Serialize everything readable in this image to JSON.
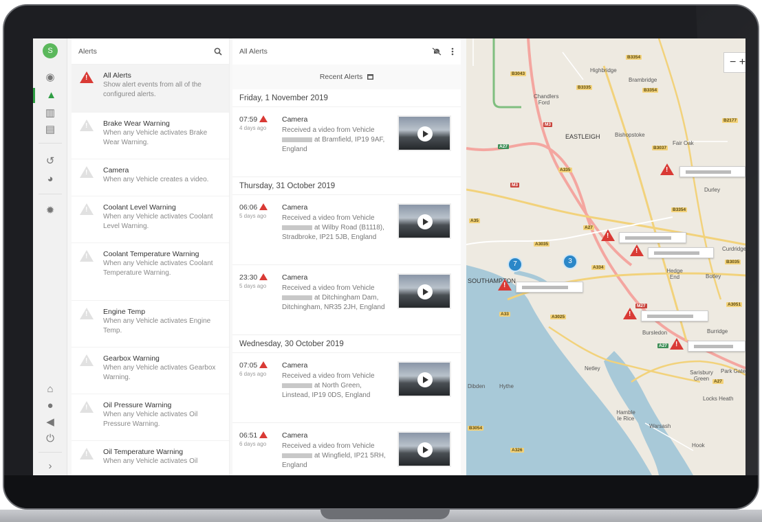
{
  "user": {
    "initial": "S"
  },
  "rail_icons": [
    {
      "name": "compass-icon",
      "glyph": "◉"
    },
    {
      "name": "alert-icon",
      "glyph": "▲"
    },
    {
      "name": "reports-chart-icon",
      "glyph": "▥"
    },
    {
      "name": "calendar-icon",
      "glyph": "▤"
    },
    {
      "name": "history-icon",
      "glyph": "↺"
    },
    {
      "name": "pie-chart-icon",
      "glyph": "◕"
    },
    {
      "name": "settings-gear-icon",
      "glyph": "✹"
    },
    {
      "name": "home-icon",
      "glyph": "⌂"
    },
    {
      "name": "user-icon",
      "glyph": "●"
    },
    {
      "name": "megaphone-icon",
      "glyph": "◀"
    },
    {
      "name": "power-icon",
      "glyph": "⏻"
    },
    {
      "name": "expand-chevron-icon",
      "glyph": "›"
    }
  ],
  "alerts_panel": {
    "title": "Alerts",
    "search_icon": "search-icon",
    "items": [
      {
        "title": "All Alerts",
        "desc": "Show alert events from all of the configured alerts.",
        "selected": true
      },
      {
        "title": "Brake Wear Warning",
        "desc": "When any Vehicle activates Brake Wear Warning."
      },
      {
        "title": "Camera",
        "desc": "When any Vehicle creates a video."
      },
      {
        "title": "Coolant Level Warning",
        "desc": "When any Vehicle activates Coolant Level Warning."
      },
      {
        "title": "Coolant Temperature Warning",
        "desc": "When any Vehicle activates Coolant Temperature Warning."
      },
      {
        "title": "Engine Temp",
        "desc": "When any Vehicle activates Engine Temp."
      },
      {
        "title": "Gearbox Warning",
        "desc": "When any Vehicle activates Gearbox Warning."
      },
      {
        "title": "Oil Pressure Warning",
        "desc": "When any Vehicle activates Oil Pressure Warning."
      },
      {
        "title": "Oil Temperature Warning",
        "desc": "When any Vehicle activates Oil"
      }
    ]
  },
  "events_panel": {
    "title": "All Alerts",
    "subheader": "Recent Alerts",
    "mute_icon": "bell-off-icon",
    "more_icon": "more-vertical-icon",
    "calendar_icon": "calendar-icon",
    "days": [
      {
        "label": "Friday, 1 November 2019",
        "events": [
          {
            "time": "07:59",
            "ago": "4 days ago",
            "type": "Camera",
            "line1": "Received a video from Vehicle",
            "line2": "at Bramfield, IP19 9AF,",
            "line3": "England"
          }
        ]
      },
      {
        "label": "Thursday, 31 October 2019",
        "events": [
          {
            "time": "06:06",
            "ago": "5 days ago",
            "type": "Camera",
            "line1": "Received a video from Vehicle",
            "line2": "at Wilby Road (B1118),",
            "line3": "Stradbroke, IP21 5JB, England"
          },
          {
            "time": "23:30",
            "ago": "5 days ago",
            "type": "Camera",
            "line1": "Received a video from Vehicle",
            "line2": "at Ditchingham Dam,",
            "line3": "Ditchingham, NR35 2JH, England"
          }
        ]
      },
      {
        "label": "Wednesday, 30 October 2019",
        "events": [
          {
            "time": "07:05",
            "ago": "6 days ago",
            "type": "Camera",
            "line1": "Received a video from Vehicle",
            "line2": "at North Green,",
            "line3": "Linstead, IP19 0DS, England"
          },
          {
            "time": "06:51",
            "ago": "6 days ago",
            "type": "Camera",
            "line1": "Received a video from Vehicle",
            "line2": "at Wingfield, IP21 5RH,",
            "line3": "England"
          }
        ]
      }
    ]
  },
  "map": {
    "zoom_out": "−",
    "zoom_in": "+",
    "clusters": [
      "7",
      "3"
    ],
    "places": [
      "Highbridge",
      "Brambridge",
      "Chandlers Ford",
      "EASTLEIGH",
      "Bishopstoke",
      "Fair Oak",
      "Durley",
      "Curdridge",
      "Hedge End",
      "Botley",
      "SOUTHAMPTON",
      "Bursledon",
      "Burridge",
      "Netley",
      "Sarisbury Green",
      "Park Gate",
      "Locks Heath",
      "Hythe",
      "Dibden",
      "Hamble le Rice",
      "Warsash",
      "Hook"
    ],
    "roads": [
      {
        "label": "B3354",
        "style": "y"
      },
      {
        "label": "B3043",
        "style": "y"
      },
      {
        "label": "B3335",
        "style": "y"
      },
      {
        "label": "B3354",
        "style": "y"
      },
      {
        "label": "B2177",
        "style": "y"
      },
      {
        "label": "M3",
        "style": "r"
      },
      {
        "label": "A27",
        "style": "g"
      },
      {
        "label": "B3037",
        "style": "y"
      },
      {
        "label": "A335",
        "style": "y"
      },
      {
        "label": "M3",
        "style": "r"
      },
      {
        "label": "B3354",
        "style": "y"
      },
      {
        "label": "A35",
        "style": "y"
      },
      {
        "label": "A27",
        "style": "y"
      },
      {
        "label": "A3035",
        "style": "y"
      },
      {
        "label": "A334",
        "style": "y"
      },
      {
        "label": "B3035",
        "style": "y"
      },
      {
        "label": "M27",
        "style": "r"
      },
      {
        "label": "A3051",
        "style": "y"
      },
      {
        "label": "A33",
        "style": "y"
      },
      {
        "label": "A3025",
        "style": "y"
      },
      {
        "label": "A27",
        "style": "g"
      },
      {
        "label": "A27",
        "style": "y"
      },
      {
        "label": "B3054",
        "style": "y"
      },
      {
        "label": "A326",
        "style": "y"
      }
    ]
  }
}
